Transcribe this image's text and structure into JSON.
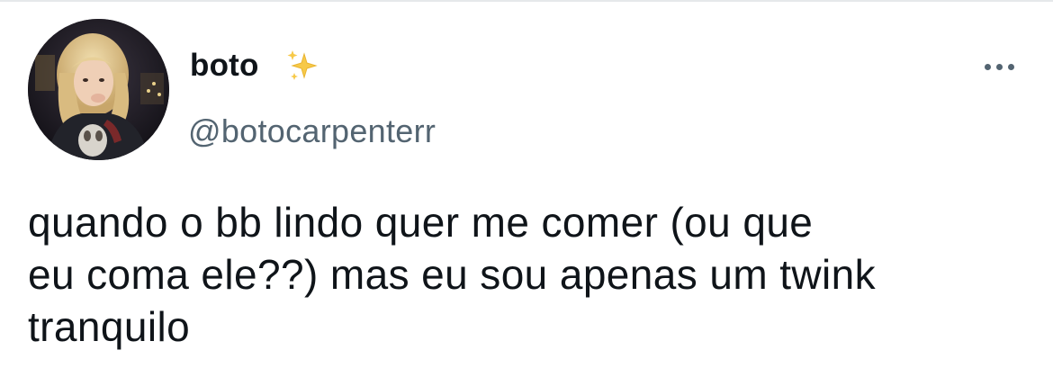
{
  "tweet": {
    "author": {
      "display_name": "boto",
      "handle": "@botocarpenterr",
      "emoji_icon": "sparkles-icon",
      "avatar": "profile-photo"
    },
    "more_icon": "more-horizontal-icon",
    "text_lines": [
      "quando o bb lindo quer me comer (ou que",
      "eu coma ele??) mas eu sou apenas um twink",
      "tranquilo"
    ]
  },
  "colors": {
    "text_primary": "#0f1419",
    "text_secondary": "#536471",
    "sparkle": "#f7c948",
    "background": "#ffffff"
  }
}
